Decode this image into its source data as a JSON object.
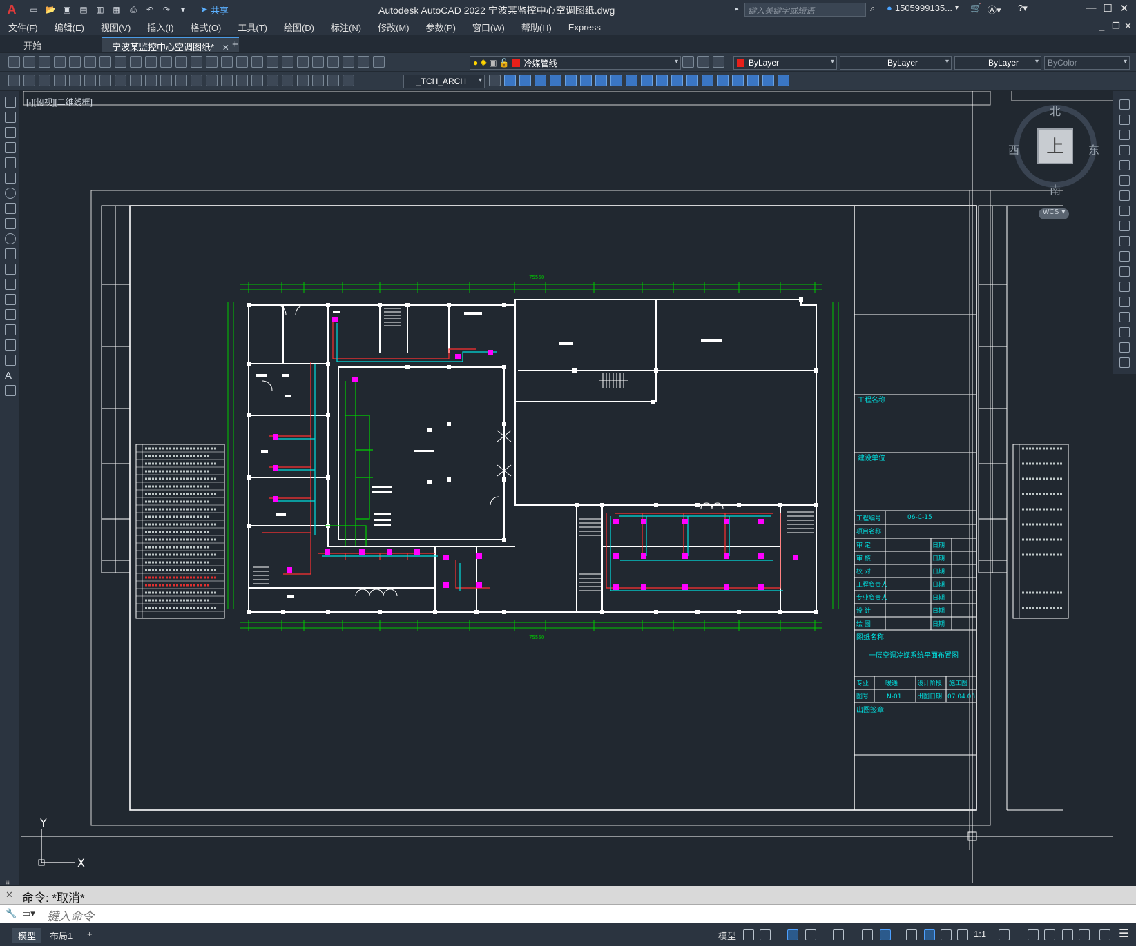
{
  "titlebar": {
    "logo": "A",
    "share_label": "共享",
    "title": "Autodesk AutoCAD 2022    宁波某监控中心空调图纸.dwg",
    "search_placeholder": "键入关键字或短语",
    "user": "1505999135...",
    "minimize": "—",
    "maximize": "☐",
    "close": "✕"
  },
  "menu": [
    "文件(F)",
    "编辑(E)",
    "视图(V)",
    "插入(I)",
    "格式(O)",
    "工具(T)",
    "绘图(D)",
    "标注(N)",
    "修改(M)",
    "参数(P)",
    "窗口(W)",
    "帮助(H)",
    "Express"
  ],
  "tabs": {
    "start": "开始",
    "active": "宁波某监控中心空调图纸*",
    "close": "✕",
    "add": "+"
  },
  "toolbar": {
    "layer": "冷媒管线",
    "layer_color": "#e8201a",
    "text_style": "_TCH_ARCH",
    "color": "ByLayer",
    "color_swatch": "#e8201a",
    "linetype": "ByLayer",
    "lineweight": "ByLayer",
    "plotstyle": "ByColor"
  },
  "viewport_label": "[-][俯视][二维线框]",
  "viewcube": {
    "north": "北",
    "south": "南",
    "east": "东",
    "west": "西",
    "face": "上",
    "wcs": "WCS"
  },
  "ucs": {
    "x": "X",
    "y": "Y"
  },
  "drawing": {
    "title_block": {
      "project_name_label": "工程名称",
      "builder_label": "建设单位",
      "project_no_label": "工程编号",
      "project_no": "06-C-15",
      "item_name_label": "项目名称",
      "rows": [
        "审    定",
        "审    核",
        "校    对",
        "工程负责人",
        "专业负责人",
        "设    计",
        "绘    图"
      ],
      "date_label": "日期",
      "drawing_name_label": "图纸名称",
      "drawing_name": "一层空调冷媒系统平面布置图",
      "spec_label": "专业",
      "spec": "暖通",
      "stage_label": "设计阶段",
      "stage": "施工图",
      "drawing_no_label": "图号",
      "drawing_no": "N-01",
      "issue_date_label": "出图日期",
      "issue_date": "07.04.03",
      "stamp_label": "出图签章"
    },
    "dimension_total": "75550"
  },
  "command": {
    "history": "命令: *取消*",
    "placeholder": "键入命令"
  },
  "status": {
    "model_tab": "模型",
    "layout_tab": "布局1",
    "add": "+",
    "model": "模型",
    "scale": "1:1"
  },
  "colors": {
    "wall": "#ffffff",
    "refrigerant_pipe": "#ff3030",
    "pipe_cyan": "#00e0e0",
    "dimension": "#00c800",
    "equipment": "#ff00ff",
    "duct": "#00d000"
  }
}
